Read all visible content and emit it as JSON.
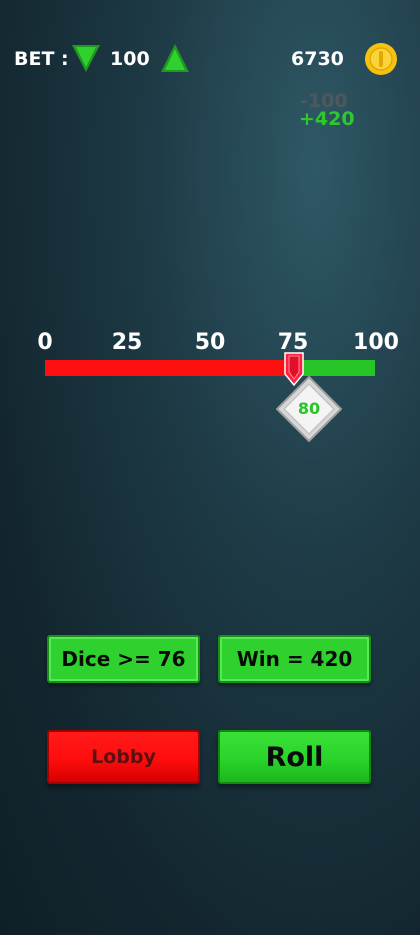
{
  "top_bar": {
    "bet_label": "BET :",
    "bet_value": "100",
    "balance": "6730"
  },
  "deltas": {
    "loss": "-100",
    "win": "+420"
  },
  "slider": {
    "ticks": [
      "0",
      "25",
      "50",
      "75",
      "100"
    ],
    "threshold": 76,
    "result": "80"
  },
  "info": {
    "condition": "Dice >= 76",
    "win": "Win = 420"
  },
  "buttons": {
    "lobby": "Lobby",
    "roll": "Roll"
  },
  "colors": {
    "lose_zone": "#ff1010",
    "win_zone": "#27c527",
    "accent_green": "#2fd12f",
    "coin_gold": "#f6c210"
  },
  "icons": [
    "bet-decrease-icon",
    "bet-increase-icon",
    "coin-icon",
    "slider-handle-icon",
    "dice-icon"
  ]
}
